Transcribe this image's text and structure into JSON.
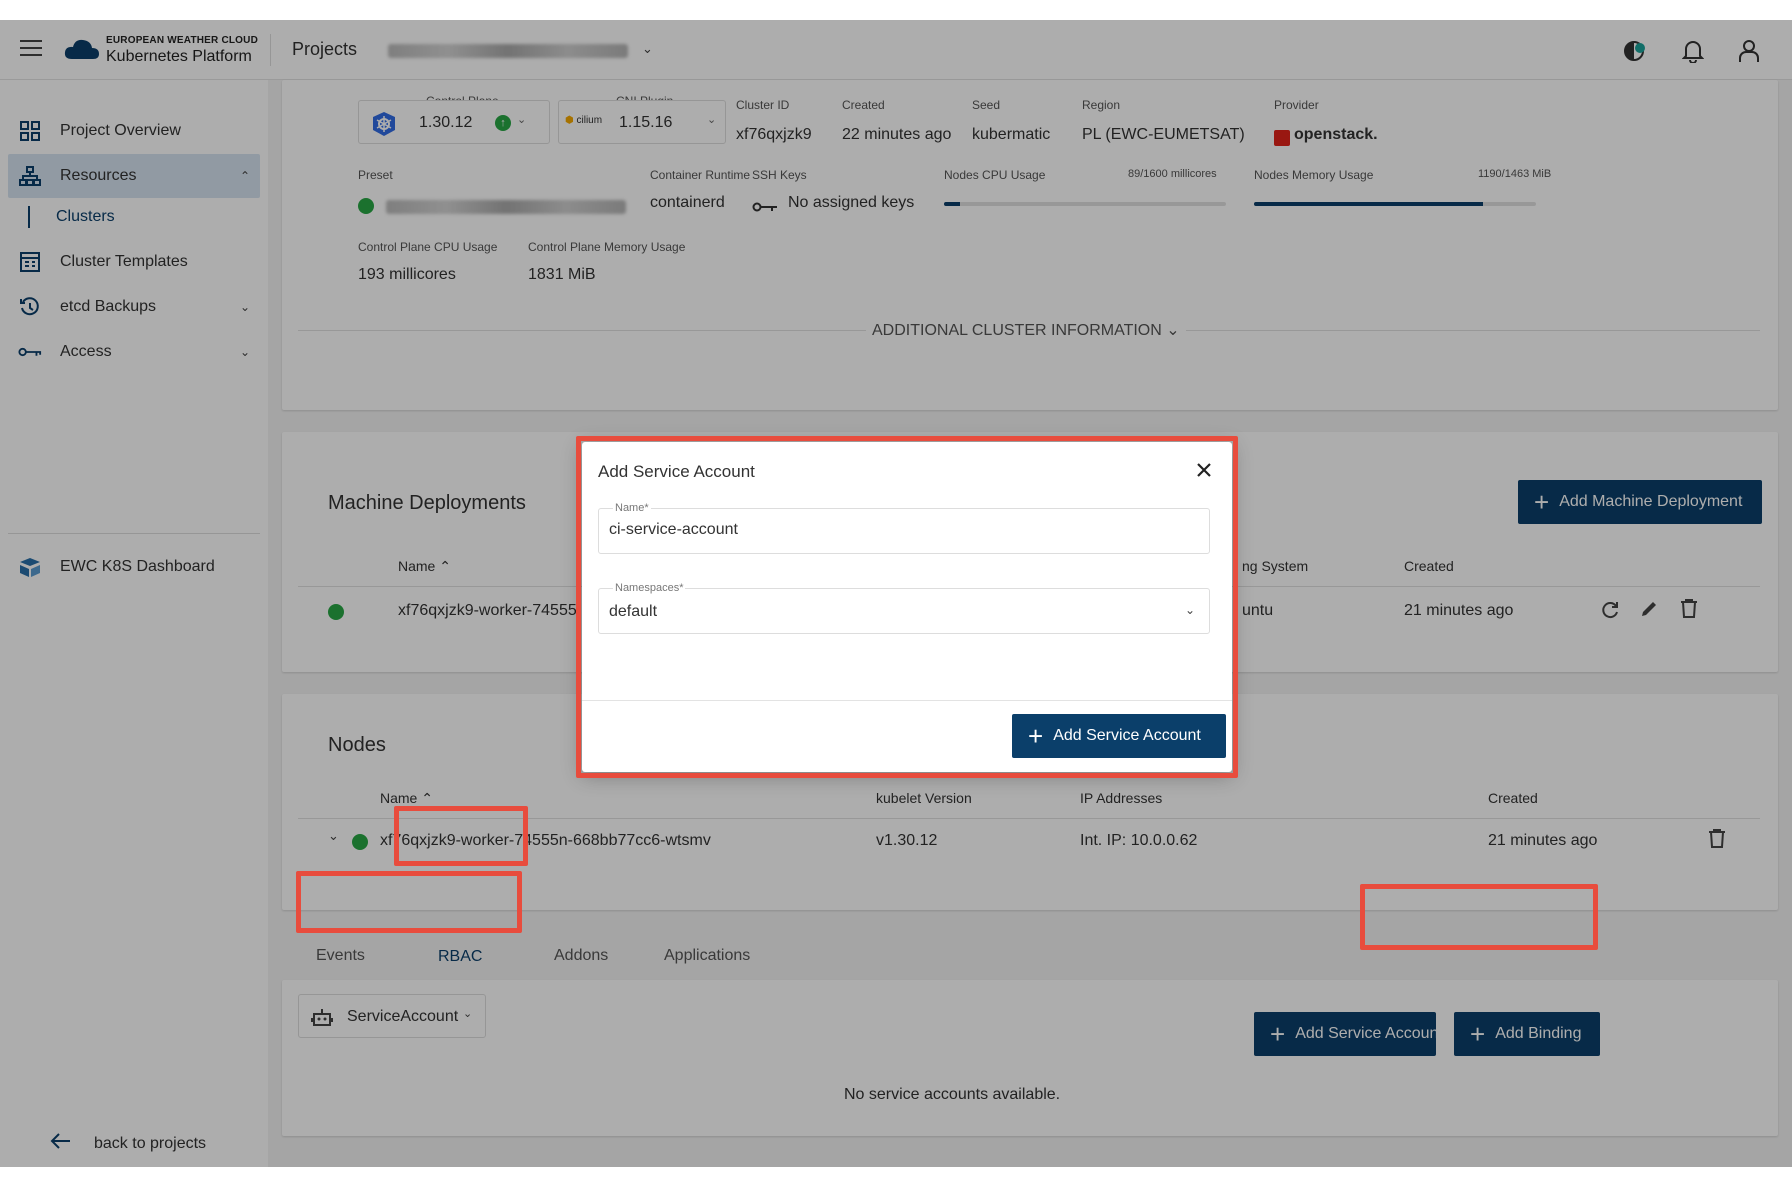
{
  "header": {
    "logo_line1": "EUROPEAN WEATHER CLOUD",
    "logo_line2": "Kubernetes Platform",
    "projects_label": "Projects",
    "icons": [
      "menu-icon",
      "theme-icon",
      "bell-icon",
      "user-icon"
    ]
  },
  "sidebar": {
    "items": [
      {
        "label": "Project Overview",
        "icon": "grid-icon"
      },
      {
        "label": "Resources",
        "icon": "hierarchy-icon"
      },
      {
        "label": "Clusters"
      },
      {
        "label": "Cluster Templates",
        "icon": "template-icon"
      },
      {
        "label": "etcd Backups",
        "icon": "history-icon"
      },
      {
        "label": "Access",
        "icon": "key-icon"
      },
      {
        "label": "EWC K8S Dashboard",
        "icon": "dashboard-icon"
      }
    ],
    "back_label": "back to projects"
  },
  "cluster": {
    "control_plane_label": "Control Plane",
    "control_plane_value": "1.30.12",
    "cni_label": "CNI Plugin",
    "cni_logo": "cilium",
    "cni_value": "1.15.16",
    "cluster_id_label": "Cluster ID",
    "cluster_id_value": "xf76qxjzk9",
    "created_label": "Created",
    "created_value": "22 minutes ago",
    "seed_label": "Seed",
    "seed_value": "kubermatic",
    "region_label": "Region",
    "region_value": "PL (EWC-EUMETSAT)",
    "provider_label": "Provider",
    "provider_value": "openstack.",
    "preset_label": "Preset",
    "runtime_label": "Container Runtime",
    "runtime_value": "containerd",
    "ssh_label": "SSH Keys",
    "ssh_value": "No assigned keys",
    "nodes_cpu_label": "Nodes CPU Usage",
    "nodes_cpu_value": "89/1600 millicores",
    "nodes_cpu_fraction": 0.056,
    "nodes_mem_label": "Nodes Memory Usage",
    "nodes_mem_value": "1190/1463 MiB",
    "nodes_mem_fraction": 0.813,
    "cp_cpu_label": "Control Plane CPU Usage",
    "cp_cpu_value": "193 millicores",
    "cp_mem_label": "Control Plane Memory Usage",
    "cp_mem_value": "1831 MiB",
    "additional_info": "ADDITIONAL CLUSTER INFORMATION"
  },
  "machine_deployments": {
    "title": "Machine Deployments",
    "add_button": "Add Machine Deployment",
    "col_name": "Name",
    "col_os": "ng System",
    "col_created": "Created",
    "row": {
      "name": "xf76qxjzk9-worker-74555",
      "os": "untu",
      "created": "21 minutes ago"
    }
  },
  "nodes": {
    "title": "Nodes",
    "col_name": "Name",
    "col_kubelet": "kubelet Version",
    "col_ip": "IP Addresses",
    "col_created": "Created",
    "row": {
      "name": "xf76qxjzk9-worker-74555n-668bb77cc6-wtsmv",
      "kubelet": "v1.30.12",
      "ip": "Int. IP: 10.0.0.62",
      "created": "21 minutes ago"
    }
  },
  "tabs": [
    "Events",
    "RBAC",
    "Addons",
    "Applications"
  ],
  "rbac": {
    "type_select": "ServiceAccount",
    "add_sa_button": "Add Service Account",
    "add_binding_button": "Add Binding",
    "empty": "No service accounts available."
  },
  "dialog": {
    "title": "Add Service Account",
    "name_label": "Name*",
    "name_value": "ci-service-account",
    "namespace_label": "Namespaces*",
    "namespace_value": "default",
    "submit": "Add Service Account"
  },
  "colors": {
    "primary": "#0b3f6a",
    "highlight": "#e84c3d",
    "status_ok": "#28a745"
  }
}
